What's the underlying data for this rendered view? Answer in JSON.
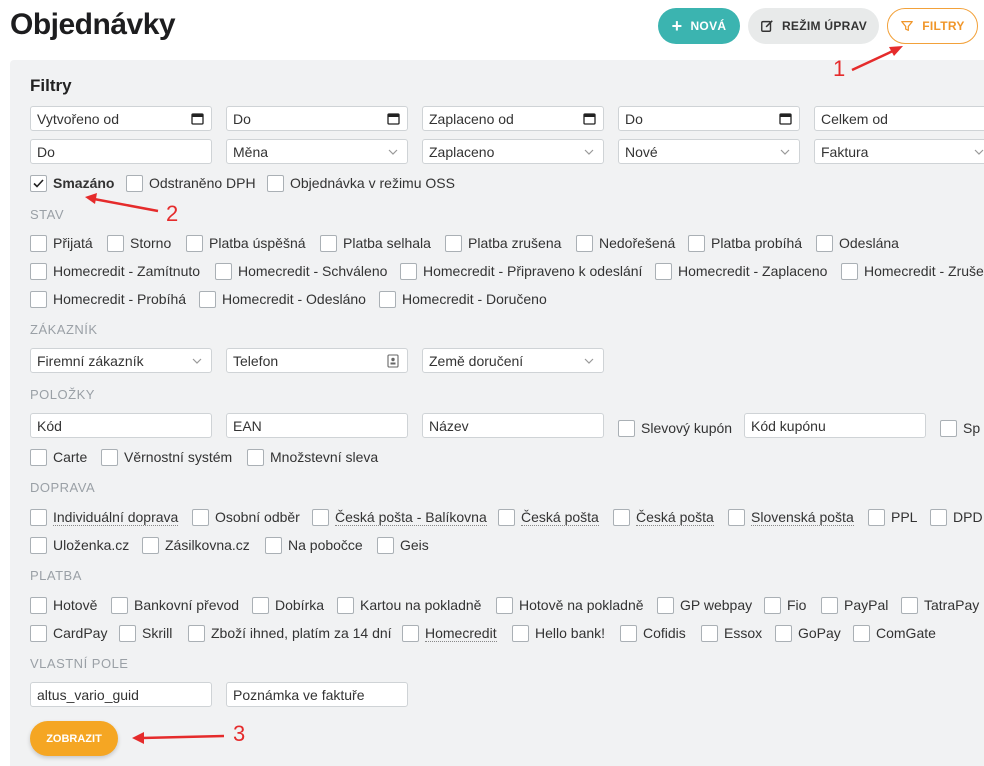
{
  "header": {
    "title": "Objednávky",
    "new_label": "NOVÁ",
    "edit_label": "REŽIM ÚPRAV",
    "filter_label": "FILTRY"
  },
  "filters": {
    "title": "Filtry",
    "row1": [
      "Vytvořeno od",
      "Do",
      "Zaplaceno od",
      "Do",
      "Celkem od"
    ],
    "row2": [
      "Do",
      "Měna",
      "Zaplaceno",
      "Nové",
      "Faktura"
    ],
    "flags": [
      {
        "label": "Smazáno",
        "checked": true
      },
      {
        "label": "Odstraněno DPH",
        "checked": false
      },
      {
        "label": "Objednávka v režimu OSS",
        "checked": false
      }
    ]
  },
  "sections": {
    "state": "STAV",
    "customer": "ZÁKAZNÍK",
    "items": "POLOŽKY",
    "shipping": "DOPRAVA",
    "payment": "PLATBA",
    "custom": "VLASTNÍ POLE"
  },
  "state_options": [
    "Přijatá",
    "Storno",
    "Platba úspěšná",
    "Platba selhala",
    "Platba zrušena",
    "Nedořešená",
    "Platba probíhá",
    "Odeslána",
    "Homecredit - Zamítnuto",
    "Homecredit - Schváleno",
    "Homecredit - Připraveno k odeslání",
    "Homecredit - Zaplaceno",
    "Homecredit - Zruše",
    "Homecredit - Probíhá",
    "Homecredit - Odesláno",
    "Homecredit - Doručeno"
  ],
  "customer": {
    "type": "Firemní zákazník",
    "phone": "Telefon",
    "country": "Země doručení"
  },
  "items": {
    "code": "Kód",
    "ean": "EAN",
    "name": "Název",
    "coupon_check": "Slevový kupón",
    "coupon_code": "Kód kupónu",
    "sp": "Sp",
    "checks": [
      "Carte",
      "Věrnostní systém",
      "Množstevní sleva"
    ]
  },
  "shipping_options": [
    "Individuální doprava",
    "Osobní odběr",
    "Česká pošta - Balíkovna",
    "Česká pošta",
    "Česká pošta",
    "Slovenská pošta",
    "PPL",
    "DPD",
    "Uloženka.cz",
    "Zásilkovna.cz",
    "Na pobočce",
    "Geis"
  ],
  "payment_options": [
    "Hotově",
    "Bankovní převod",
    "Dobírka",
    "Kartou na pokladně",
    "Hotově na pokladně",
    "GP webpay",
    "Fio",
    "PayPal",
    "TatraPay",
    "CardPay",
    "Skrill",
    "Zboží ihned, platím za 14 dní",
    "Homecredit",
    "Hello bank!",
    "Cofidis",
    "Essox",
    "GoPay",
    "ComGate"
  ],
  "custom_fields": [
    "altus_vario_guid",
    "Poznámka ve faktuře"
  ],
  "show_label": "ZOBRAZIT",
  "annotations": [
    "1",
    "2",
    "3"
  ],
  "colors": {
    "accent_teal": "#3bb4b0",
    "accent_orange": "#f5a623",
    "annotation_red": "#e52b2b"
  }
}
